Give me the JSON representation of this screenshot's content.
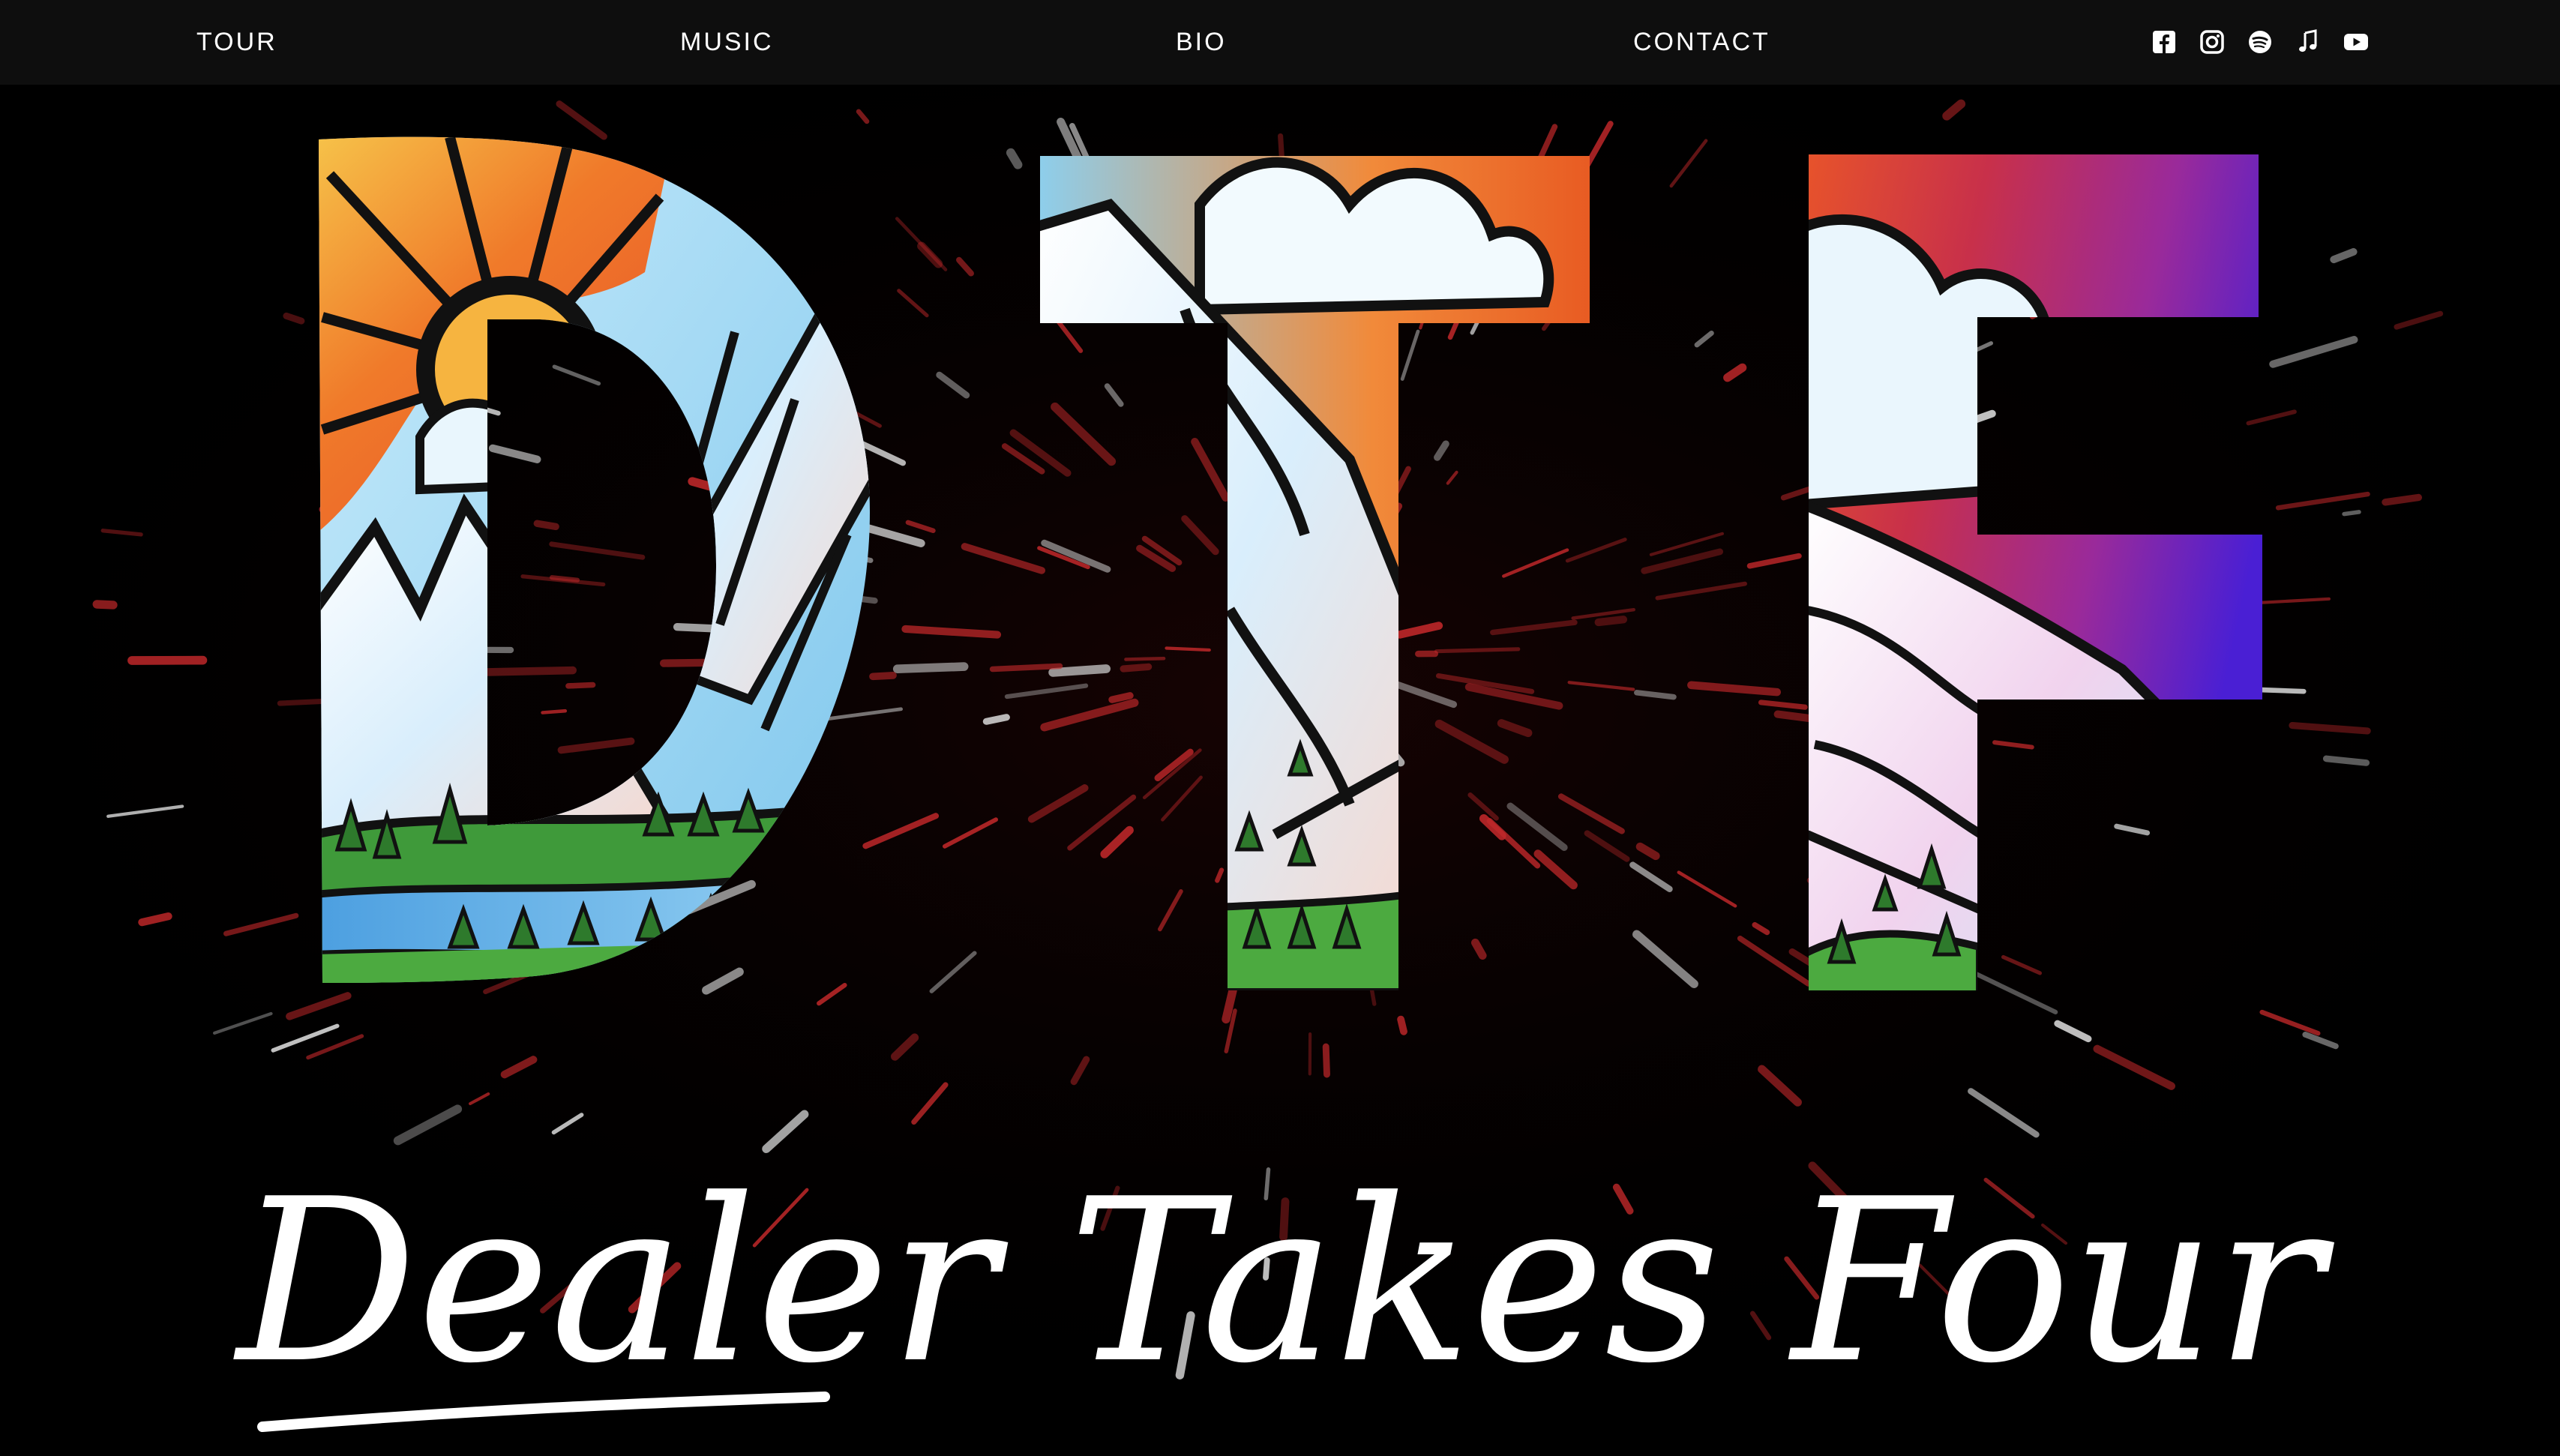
{
  "nav": {
    "links": [
      {
        "label": "TOUR"
      },
      {
        "label": "MUSIC"
      },
      {
        "label": "BIO"
      },
      {
        "label": "CONTACT"
      }
    ],
    "socials": [
      "facebook-icon",
      "instagram-icon",
      "spotify-icon",
      "music-note-icon",
      "youtube-icon"
    ]
  },
  "hero": {
    "logo_letters": "DTF",
    "band_name": "Dealer Takes Four"
  },
  "colors": {
    "background": "#000000",
    "nav_background": "#0e0e0e",
    "text": "#ffffff",
    "sun_orange": "#f07a2a",
    "sky_blue": "#8fd0ef",
    "purple": "#5a1fd0",
    "grass": "#3f9a3a",
    "spark_red": "#c0282a"
  }
}
